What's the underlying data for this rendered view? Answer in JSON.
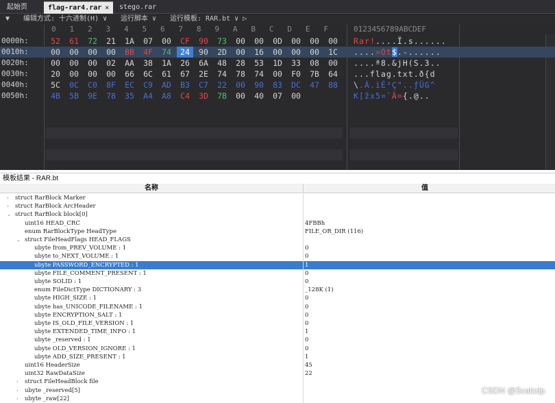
{
  "tabs": [
    {
      "label": "起始页",
      "active": false
    },
    {
      "label": "flag-rar4.rar",
      "active": true
    },
    {
      "label": "stego.rar",
      "active": false
    }
  ],
  "toolbar": {
    "collapse_glyph": "▼",
    "encoding": "编辑方式: 十六进制(H) ∨",
    "run_script": "运行脚本 ∨",
    "run_template": "运行模板: RAR.bt ∨ ▷"
  },
  "hex": {
    "column_header": "0   1   2   3   4   5   6   7   8   9   A   B   C   D   E   F",
    "ascii_header": "0123456789ABCDEF",
    "rows": [
      {
        "address": "0000h:",
        "bytes": [
          "52",
          "61",
          "72",
          "21",
          "1A",
          "07",
          "00",
          "CF",
          "90",
          "73",
          "00",
          "00",
          "0D",
          "00",
          "00",
          "00"
        ],
        "ascii": "Rar!....Ï.s......"
      },
      {
        "address": "0010h:",
        "bytes": [
          "00",
          "00",
          "00",
          "00",
          "BB",
          "4F",
          "74",
          "24",
          "90",
          "2D",
          "00",
          "16",
          "00",
          "00",
          "00",
          "1C"
        ],
        "ascii": "....»Ot$.-......"
      },
      {
        "address": "0020h:",
        "bytes": [
          "00",
          "00",
          "00",
          "02",
          "AA",
          "38",
          "1A",
          "26",
          "6A",
          "48",
          "28",
          "53",
          "1D",
          "33",
          "08",
          "00"
        ],
        "ascii": "....ª8.&jH(S.3.."
      },
      {
        "address": "0030h:",
        "bytes": [
          "20",
          "00",
          "00",
          "00",
          "66",
          "6C",
          "61",
          "67",
          "2E",
          "74",
          "78",
          "74",
          "00",
          "F0",
          "7B",
          "64"
        ],
        "ascii": "...flag.txt.ð{d"
      },
      {
        "address": "0040h:",
        "bytes": [
          "5C",
          "0C",
          "C0",
          "8F",
          "EC",
          "C9",
          "AD",
          "B3",
          "C7",
          "22",
          "00",
          "90",
          "83",
          "DC",
          "47",
          "88"
        ],
        "ascii": "\\.À.ìÉ­³Ç\"..ƒÜG^"
      },
      {
        "address": "0050h:",
        "bytes": [
          "4B",
          "5B",
          "9E",
          "78",
          "35",
          "A4",
          "A8",
          "C4",
          "3D",
          "7B",
          "00",
          "40",
          "07",
          "00"
        ],
        "ascii": "K[žx5¤¨Ä={.@.."
      }
    ]
  },
  "template": {
    "results_label": "模板结果 - RAR.bt",
    "col_name": "名称",
    "col_value": "值",
    "rows": [
      {
        "name": "struct RarBlock Marker",
        "value": "",
        "indent": 0,
        "toggle": "›"
      },
      {
        "name": "struct RarBlock ArcHeader",
        "value": "",
        "indent": 0,
        "toggle": "›"
      },
      {
        "name": "struct RarBlock block[0]",
        "value": "",
        "indent": 0,
        "toggle": "⌄"
      },
      {
        "name": "uint16 HEAD_CRC",
        "value": "4FBBh",
        "indent": 1,
        "toggle": ""
      },
      {
        "name": "enum RarBlockType HeadType",
        "value": "FILE_OR_DIR (116)",
        "indent": 1,
        "toggle": ""
      },
      {
        "name": "struct FileHeadFlags HEAD_FLAGS",
        "value": "",
        "indent": 1,
        "toggle": "⌄"
      },
      {
        "name": "ubyte from_PREV_VOLUME : 1",
        "value": "0",
        "indent": 2,
        "toggle": ""
      },
      {
        "name": "ubyte to_NEXT_VOLUME : 1",
        "value": "0",
        "indent": 2,
        "toggle": ""
      },
      {
        "name": "ubyte PASSWORD_ENCRYPTED : 1",
        "value": "1",
        "indent": 2,
        "toggle": "",
        "selected": true
      },
      {
        "name": "ubyte FILE_COMMENT_PRESENT : 1",
        "value": "0",
        "indent": 2,
        "toggle": ""
      },
      {
        "name": "ubyte SOLID : 1",
        "value": "0",
        "indent": 2,
        "toggle": ""
      },
      {
        "name": "enum FileDictType DICTIONARY : 3",
        "value": "_128K (1)",
        "indent": 2,
        "toggle": ""
      },
      {
        "name": "ubyte HIGH_SIZE : 1",
        "value": "0",
        "indent": 2,
        "toggle": ""
      },
      {
        "name": "ubyte has_UNICODE_FILENAME : 1",
        "value": "0",
        "indent": 2,
        "toggle": ""
      },
      {
        "name": "ubyte ENCRYPTION_SALT : 1",
        "value": "0",
        "indent": 2,
        "toggle": ""
      },
      {
        "name": "ubyte IS_OLD_FILE_VERSION : 1",
        "value": "0",
        "indent": 2,
        "toggle": ""
      },
      {
        "name": "ubyte EXTENDED_TIME_INFO : 1",
        "value": "1",
        "indent": 2,
        "toggle": ""
      },
      {
        "name": "ubyte _reserved : 1",
        "value": "0",
        "indent": 2,
        "toggle": ""
      },
      {
        "name": "ubyte OLD_VERSION_IGNORE : 1",
        "value": "0",
        "indent": 2,
        "toggle": ""
      },
      {
        "name": "ubyte ADD_SIZE_PRESENT : 1",
        "value": "1",
        "indent": 2,
        "toggle": ""
      },
      {
        "name": "uint16 HeaderSize",
        "value": "45",
        "indent": 1,
        "toggle": ""
      },
      {
        "name": "uint32 RawDataSize",
        "value": "22",
        "indent": 1,
        "toggle": ""
      },
      {
        "name": "struct FileHeadBlock file",
        "value": "",
        "indent": 1,
        "toggle": "›"
      },
      {
        "name": "ubyte _reserved[5]",
        "value": "",
        "indent": 1,
        "toggle": "›"
      },
      {
        "name": "ubyte _raw[22]",
        "value": "",
        "indent": 1,
        "toggle": "›"
      }
    ]
  },
  "watermark": "CSDN @Scalzdp",
  "colors": {
    "hex_background": "#2a2a2d",
    "selection": "#3a7cd0",
    "marker_red": "#e04848",
    "marker_blue": "#4a6fd0",
    "marker_green": "#44c86a"
  }
}
